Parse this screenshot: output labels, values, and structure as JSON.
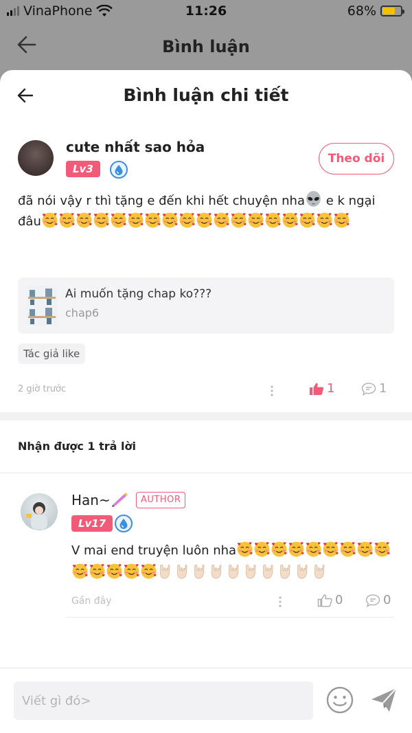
{
  "status_bar": {
    "carrier": "VinaPhone",
    "time": "11:26",
    "battery": "68%"
  },
  "outer_header": {
    "title": "Bình luận"
  },
  "sheet": {
    "title": "Bình luận chi tiết",
    "comment": {
      "author": "cute nhất sao hỏa",
      "level": "Lv3",
      "follow_label": "Theo dõi",
      "text_line1": "đã nói vậy r thì tặng e đến khi hết chuyện nha",
      "text_line1_tail": " e k ngại",
      "text_line2": "đâu",
      "ref_card": {
        "title": "Ai muốn tặng chap ko???",
        "subtitle": "chap6"
      },
      "tag": "Tác giả like",
      "time": "2 giờ trước",
      "likes": "1",
      "replies": "1"
    },
    "replies_header": "Nhận được 1 trả lời",
    "reply": {
      "author": "Han~",
      "author_badge": "AUTHOR",
      "level": "Lv17",
      "text": "V mai end truyện luôn nha",
      "time": "Gần đây",
      "likes": "0",
      "replies": "0"
    },
    "input": {
      "placeholder": "Viết gì đó>"
    }
  },
  "colors": {
    "accent": "#f25b78",
    "overlay": "#9a9a9a",
    "level_badge": "#f25b78",
    "drop_badge": "#3a8fe0"
  },
  "icons": [
    "back-arrow-icon",
    "water-drop-icon",
    "thumbs-up-icon",
    "comment-bubble-icon",
    "smiley-icon",
    "send-icon",
    "alien-emoji",
    "smiling-face-with-hearts-emoji",
    "rock-on-hand-emoji"
  ]
}
